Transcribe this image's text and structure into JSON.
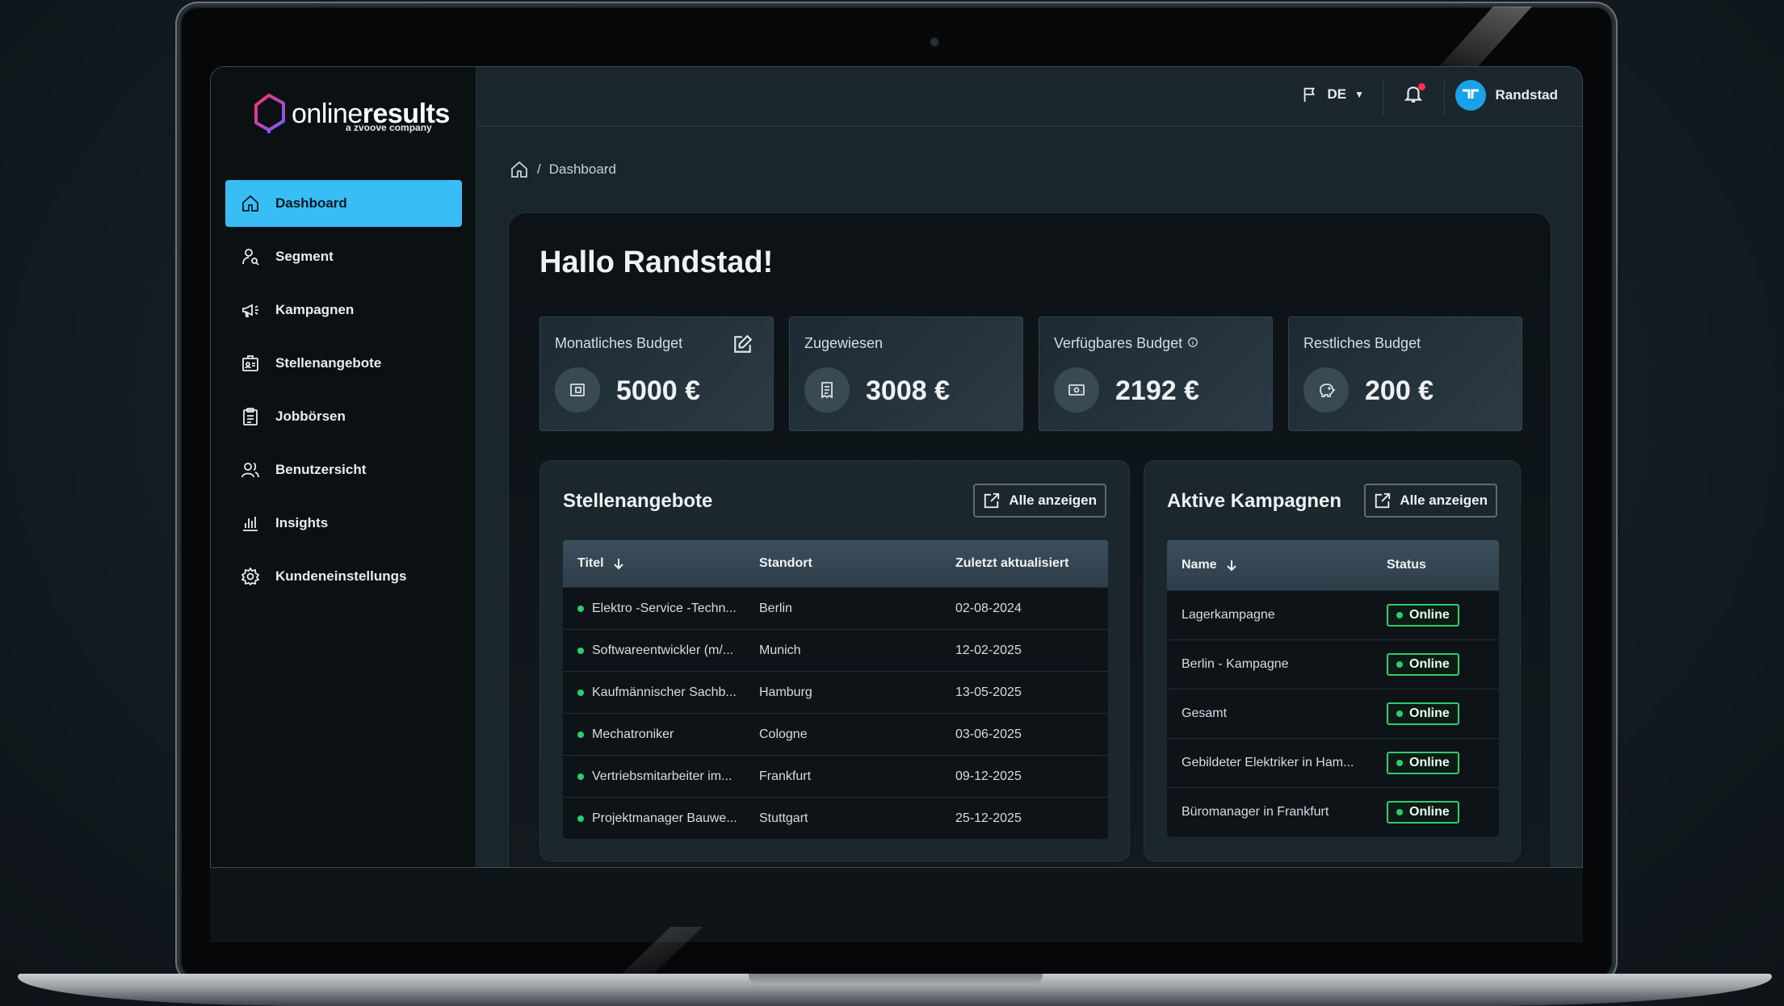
{
  "brand": {
    "name_light": "online",
    "name_bold": "results",
    "tagline": "a zvoove company"
  },
  "sidebar": {
    "items": [
      {
        "label": "Dashboard",
        "icon": "home-icon",
        "active": true
      },
      {
        "label": "Segment",
        "icon": "user-search-icon",
        "active": false
      },
      {
        "label": "Kampagnen",
        "icon": "megaphone-icon",
        "active": false
      },
      {
        "label": "Stellenangebote",
        "icon": "id-badge-icon",
        "active": false
      },
      {
        "label": "Jobbörsen",
        "icon": "clipboard-icon",
        "active": false
      },
      {
        "label": "Benutzersicht",
        "icon": "users-icon",
        "active": false
      },
      {
        "label": "Insights",
        "icon": "bar-chart-icon",
        "active": false
      },
      {
        "label": "Kundeneinstellungs",
        "icon": "gear-icon",
        "active": false
      }
    ]
  },
  "topbar": {
    "language": "DE",
    "user_name": "Randstad",
    "avatar_text": "randstad"
  },
  "breadcrumb": {
    "current": "Dashboard"
  },
  "main": {
    "greeting": "Hallo Randstad!",
    "cards": [
      {
        "label": "Monatliches Budget",
        "value": "5000 €"
      },
      {
        "label": "Zugewiesen",
        "value": "3008 €"
      },
      {
        "label": "Verfügbares Budget",
        "value": "2192 €"
      },
      {
        "label": "Restliches Budget",
        "value": "200 €"
      }
    ]
  },
  "jobs": {
    "title": "Stellenangebote",
    "show_all": "Alle anzeigen",
    "columns": [
      "Titel",
      "Standort",
      "Zuletzt aktualisiert"
    ],
    "rows": [
      [
        "Elektro -Service -Techn...",
        "Berlin",
        "02-08-2024"
      ],
      [
        "Softwareentwickler (m/...",
        "Munich",
        "12-02-2025"
      ],
      [
        "Kaufmännischer Sachb...",
        "Hamburg",
        "13-05-2025"
      ],
      [
        "Mechatroniker",
        "Cologne",
        "03-06-2025"
      ],
      [
        "Vertriebsmitarbeiter im...",
        "Frankfurt",
        "09-12-2025"
      ],
      [
        "Projektmanager Bauwe...",
        "Stuttgart",
        "25-12-2025"
      ]
    ]
  },
  "campaigns": {
    "title": "Aktive Kampagnen",
    "show_all": "Alle anzeigen",
    "columns": [
      "Name",
      "Status"
    ],
    "rows": [
      [
        "Lagerkampagne",
        "Online"
      ],
      [
        "Berlin - Kampagne",
        "Online"
      ],
      [
        "Gesamt",
        "Online"
      ],
      [
        "Gebildeter Elektriker in Ham...",
        "Online"
      ],
      [
        "Büromanager in Frankfurt",
        "Online"
      ]
    ]
  },
  "colors": {
    "accent": "#38bdf4",
    "status_online": "#2ecc71",
    "notification": "#ff2e4d"
  }
}
